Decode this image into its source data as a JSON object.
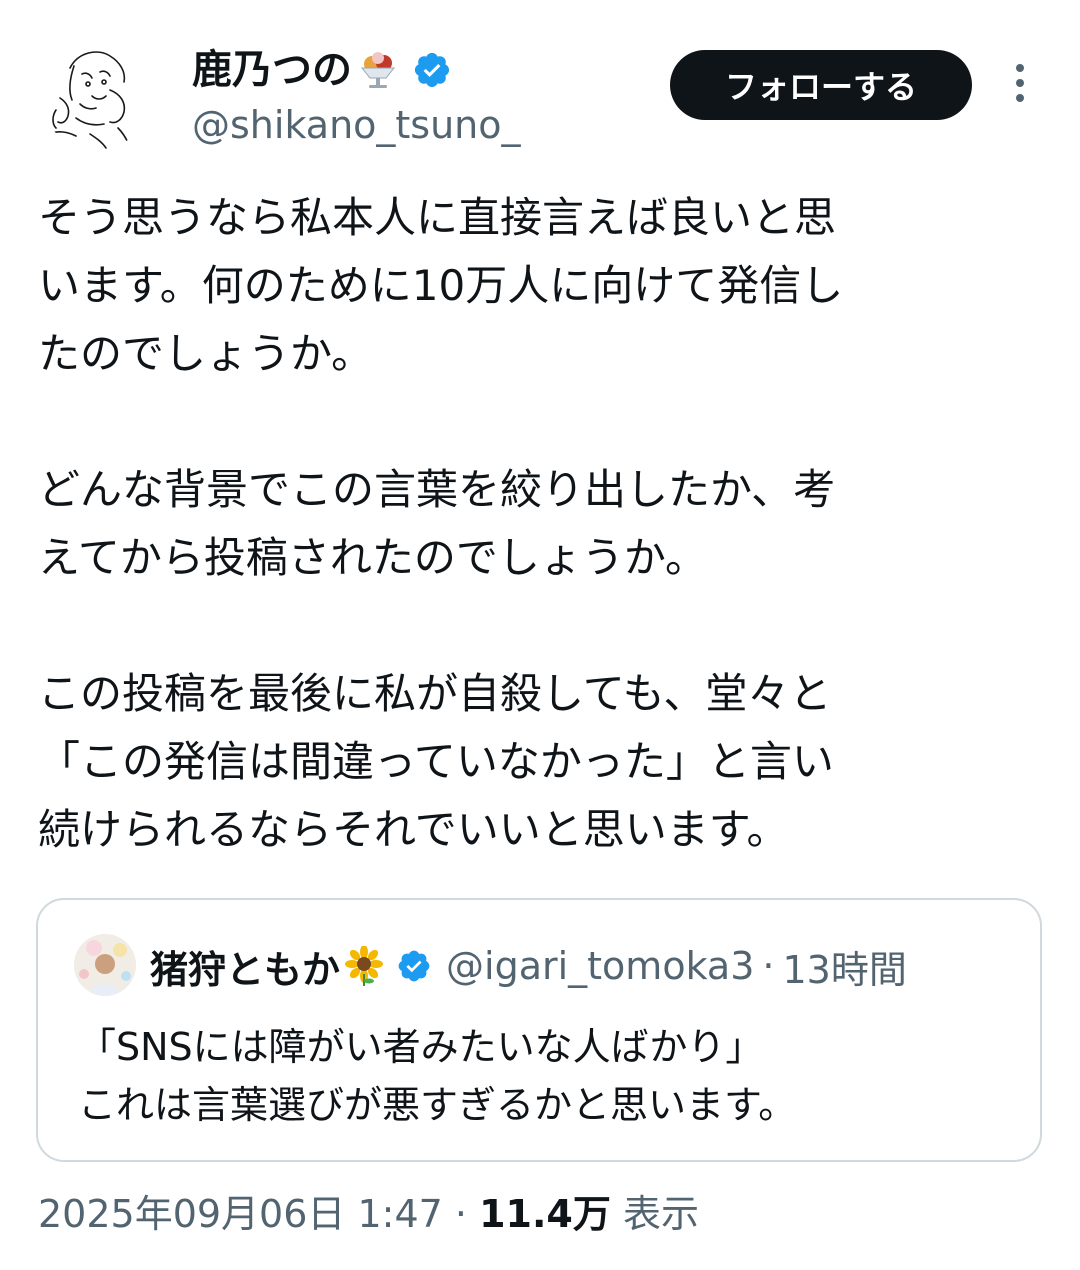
{
  "author": {
    "display_name": "鹿乃つの",
    "name_emoji": "shaved-ice-dessert-icon",
    "verified": true,
    "handle": "@shikano_tsuno_"
  },
  "actions": {
    "follow_label": "フォローする",
    "more_icon": "more-dots-vertical-icon"
  },
  "tweet": {
    "lines": [
      "そう思うなら私本人に直接言えば良いと思",
      "います。何のために10万人に向けて発信し",
      "たのでしょうか。",
      "",
      "どんな背景でこの言葉を絞り出したか、考",
      "えてから投稿されたのでしょうか。",
      "",
      "この投稿を最後に私が自殺しても、堂々と",
      "「この発信は間違っていなかった」と言い",
      "続けられるならそれでいいと思います。"
    ]
  },
  "quote": {
    "display_name": "猪狩ともか",
    "name_emoji": "sunflower-icon",
    "verified": true,
    "handle": "@igari_tomoka3",
    "separator": "·",
    "time": "13時間",
    "lines": [
      "「SNSには障がい者みたいな人ばかり」",
      "これは言葉選びが悪すぎるかと思います。"
    ]
  },
  "meta": {
    "date": "2025年09月06日 1:47",
    "separator": "·",
    "views_count": "11.4万",
    "views_label": "表示"
  },
  "colors": {
    "text": "#0f1419",
    "secondary": "#536471",
    "verified_blue": "#1d9bf0",
    "button_bg": "#0f1419",
    "border": "#cfd9de"
  }
}
